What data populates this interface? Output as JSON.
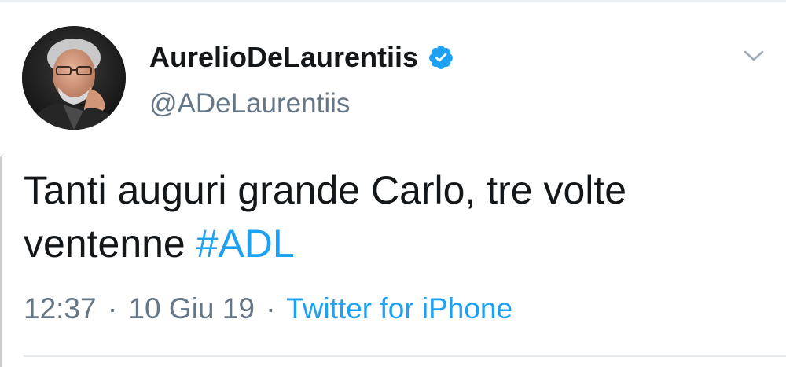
{
  "tweet": {
    "author": {
      "display_name": "AurelioDeLaurentiis",
      "handle": "@ADeLaurentiis",
      "verified": true,
      "avatar_icon": "profile-photo"
    },
    "text_line1": "Tanti auguri grande Carlo, tre volte",
    "text_line2_prefix": "ventenne ",
    "hashtag": "#ADL",
    "time": "12:37",
    "separator": "·",
    "date": "10 Giu 19",
    "source": "Twitter for iPhone",
    "menu_icon": "chevron-down-icon"
  },
  "colors": {
    "accent": "#1da1f2",
    "text_primary": "#14171a",
    "text_secondary": "#657786",
    "divider": "#e6ecf0"
  }
}
